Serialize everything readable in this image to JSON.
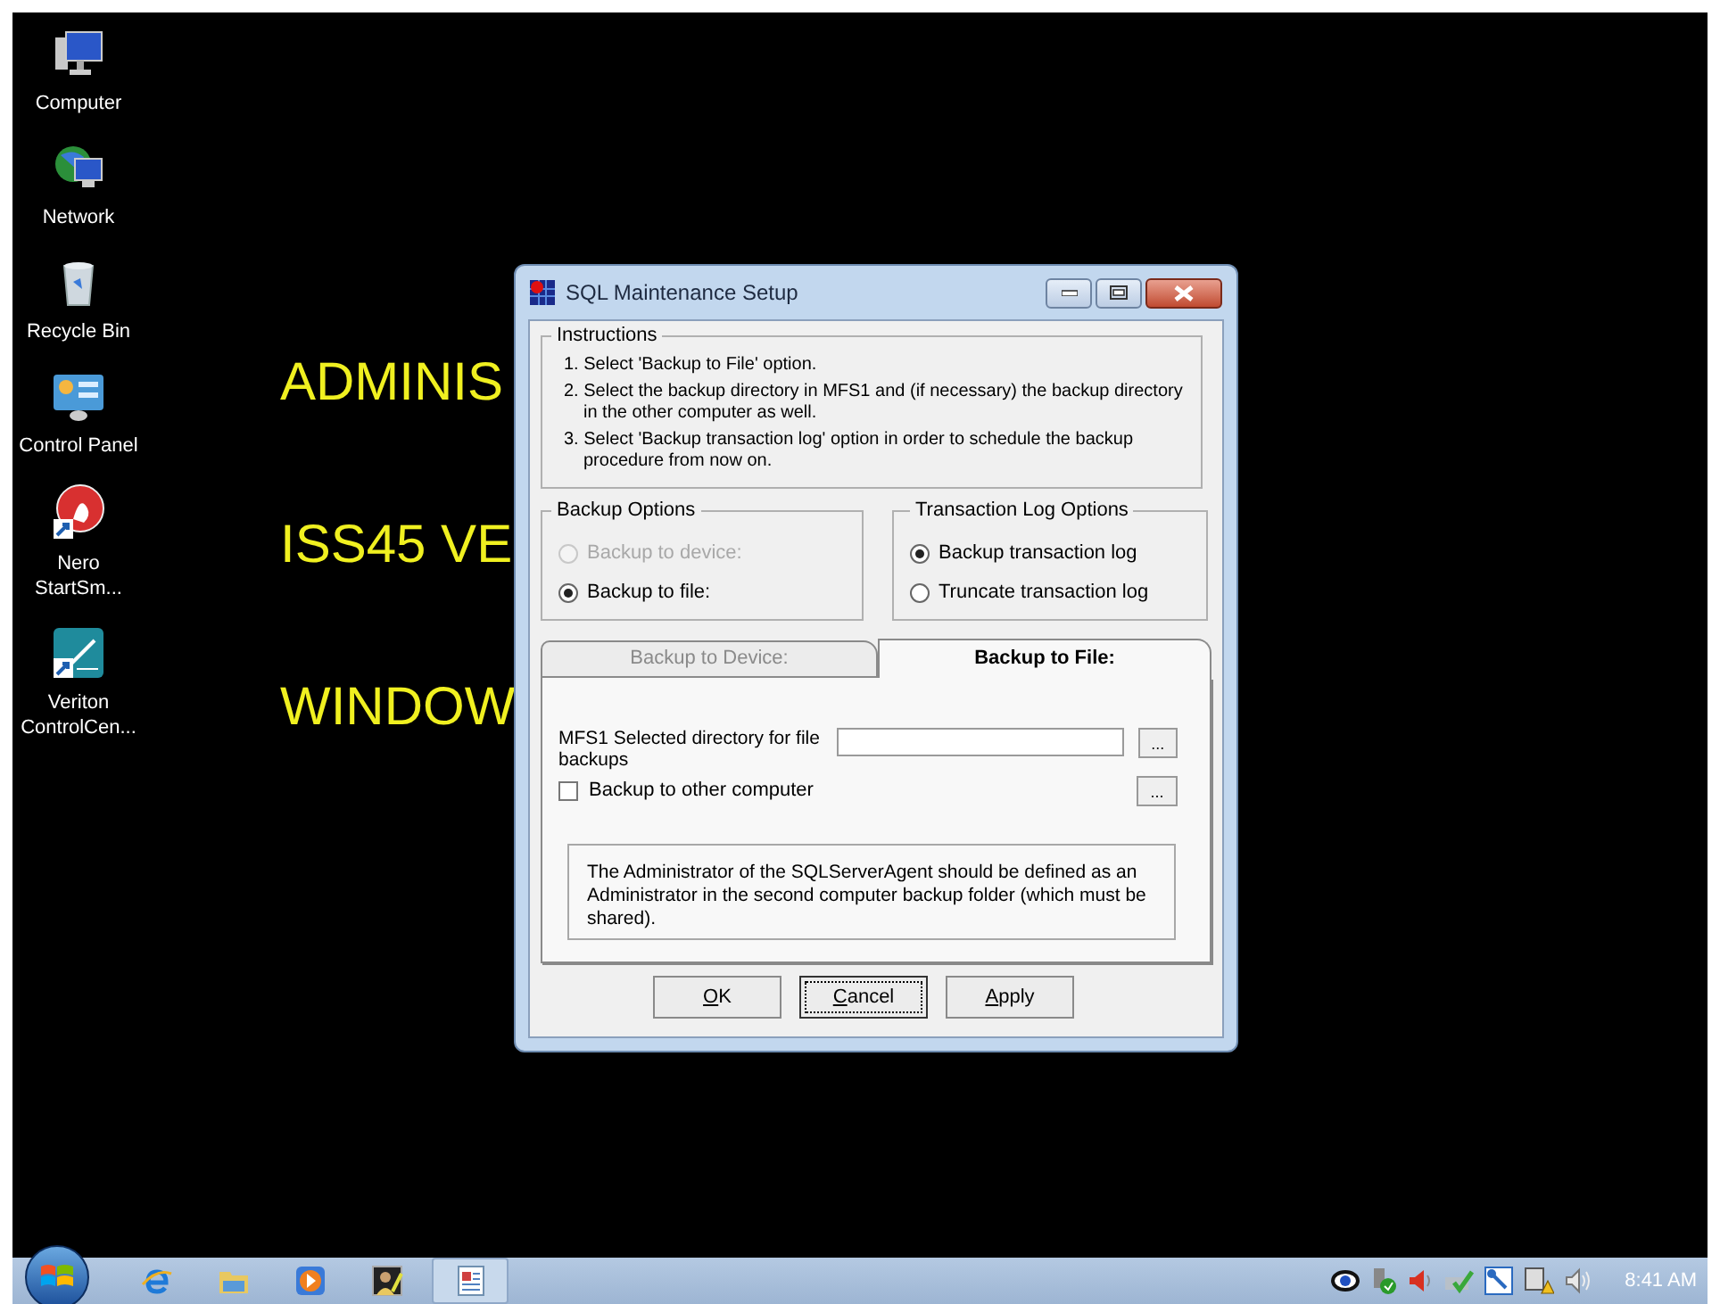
{
  "desktop_icons": [
    {
      "kind": "computer",
      "label": "Computer"
    },
    {
      "kind": "network",
      "label": "Network"
    },
    {
      "kind": "recycle",
      "label": "Recycle Bin"
    },
    {
      "kind": "control",
      "label": "Control Panel"
    },
    {
      "kind": "nero",
      "label": "Nero StartSm..."
    },
    {
      "kind": "veriton",
      "label": "Veriton ControlCen..."
    }
  ],
  "wallpaper_text": [
    "ADMINIS",
    "ISS45 VE",
    "WINDOW"
  ],
  "dialog": {
    "title": "SQL Maintenance Setup",
    "instructions": {
      "title": "Instructions",
      "steps": [
        "1. Select 'Backup to File' option.",
        "2. Select the backup directory in MFS1 and (if necessary) the backup directory in the other computer as well.",
        "3. Select 'Backup transaction log' option in order to schedule the backup procedure from now on."
      ]
    },
    "backup_options": {
      "title": "Backup Options",
      "options": [
        {
          "label": "Backup to device:",
          "selected": false,
          "disabled": true
        },
        {
          "label": "Backup to file:",
          "selected": true,
          "disabled": false
        }
      ]
    },
    "log_options": {
      "title": "Transaction Log Options",
      "options": [
        {
          "label": "Backup transaction log",
          "selected": true,
          "disabled": false
        },
        {
          "label": "Truncate transaction log",
          "selected": false,
          "disabled": false
        }
      ]
    },
    "tabs": [
      {
        "label": "Backup to Device:",
        "selected": false
      },
      {
        "label": "Backup to File:",
        "selected": true
      }
    ],
    "directory_label": "MFS1 Selected directory for file backups",
    "browse_buttons": [
      "...",
      "..."
    ],
    "other_computer": {
      "label": "Backup to other computer",
      "checked": false
    },
    "note": "The Administrator of the SQLServerAgent should be defined as an Administrator in the second computer backup folder (which must be shared).",
    "buttons": [
      {
        "label": "OK",
        "focused": false
      },
      {
        "label": "Cancel",
        "focused": true
      },
      {
        "label": "Apply",
        "focused": false
      }
    ]
  },
  "taskbar": {
    "items": [
      {
        "kind": "ie",
        "selected": false
      },
      {
        "kind": "folder",
        "selected": false
      },
      {
        "kind": "media",
        "selected": false
      },
      {
        "kind": "tool",
        "selected": false
      },
      {
        "kind": "app",
        "selected": true
      }
    ],
    "tray": [
      {
        "kind": "eye"
      },
      {
        "kind": "usb"
      },
      {
        "kind": "speaker-red"
      },
      {
        "kind": "check"
      },
      {
        "kind": "tool"
      },
      {
        "kind": "network"
      },
      {
        "kind": "volume"
      }
    ],
    "clock": "8:41 AM"
  }
}
